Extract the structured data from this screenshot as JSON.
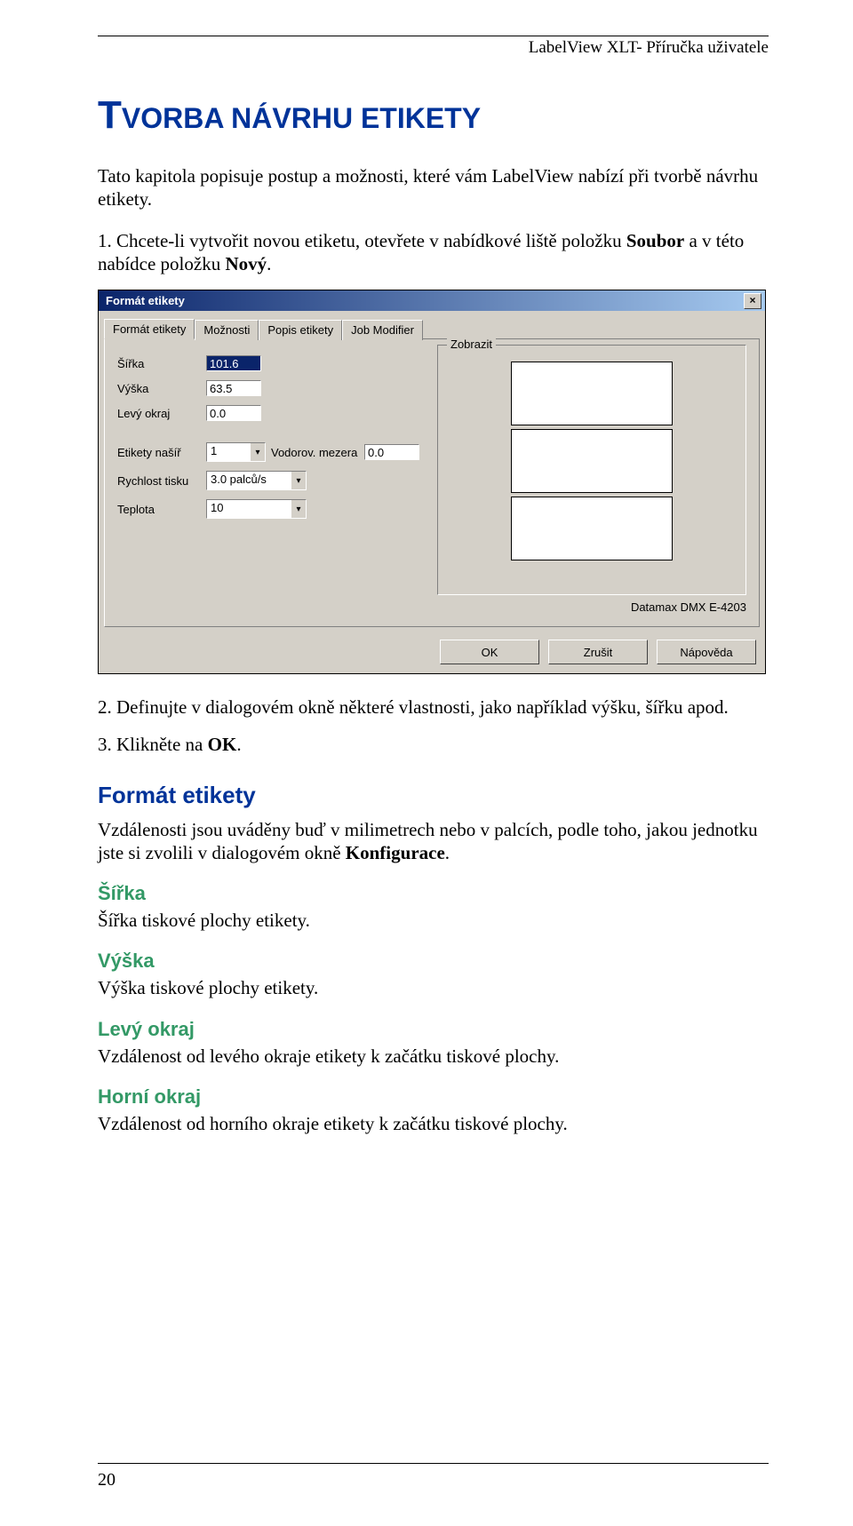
{
  "header": "LabelView XLT- Příručka uživatele",
  "title": "TVORBA NÁVRHU ETIKETY",
  "intro": "Tato kapitola popisuje postup a možnosti, které vám LabelView nabízí při tvorbě návrhu etikety.",
  "step1_pre": "1. Chcete-li vytvořit novou etiketu, otevřete v nabídkové liště položku ",
  "step1_b1": "Soubor",
  "step1_mid": " a v této nabídce položku ",
  "step1_b2": "Nový",
  "step1_end": ".",
  "step2": "2. Definujte v dialogovém okně některé vlastnosti, jako například výšku, šířku apod.",
  "step3_pre": "3. Klikněte na ",
  "step3_b": "OK",
  "step3_end": ".",
  "section_format": "Formát etikety",
  "format_p_pre": "Vzdálenosti jsou uváděny buď v milimetrech nebo v palcích, podle toho, jakou jednotku jste si zvolili v dialogovém okně ",
  "format_p_b": "Konfigurace",
  "format_p_end": ".",
  "h_sirka": "Šířka",
  "p_sirka": "Šířka tiskové plochy etikety.",
  "h_vyska": "Výška",
  "p_vyska": "Výška tiskové plochy etikety.",
  "h_levy": "Levý okraj",
  "p_levy": "Vzdálenost od levého okraje etikety k začátku tiskové plochy.",
  "h_horni": "Horní okraj",
  "p_horni": "Vzdálenost od horního okraje etikety k začátku tiskové plochy.",
  "page_num": "20",
  "dialog": {
    "title": "Formát etikety",
    "tabs": [
      "Formát etikety",
      "Možnosti",
      "Popis etikety",
      "Job Modifier"
    ],
    "labels": {
      "sirka": "Šířka",
      "vyska": "Výška",
      "levy": "Levý okraj",
      "nasir": "Etikety našíř",
      "vodor": "Vodorov. mezera",
      "rychlost": "Rychlost tisku",
      "teplota": "Teplota",
      "zobrazit": "Zobrazit"
    },
    "values": {
      "sirka": "101.6",
      "vyska": "63.5",
      "levy": "0.0",
      "nasir": "1",
      "vodor": "0.0",
      "rychlost": "3.0 palců/s",
      "teplota": "10"
    },
    "printer": "Datamax DMX E-4203",
    "buttons": {
      "ok": "OK",
      "cancel": "Zrušit",
      "help": "Nápověda"
    }
  }
}
